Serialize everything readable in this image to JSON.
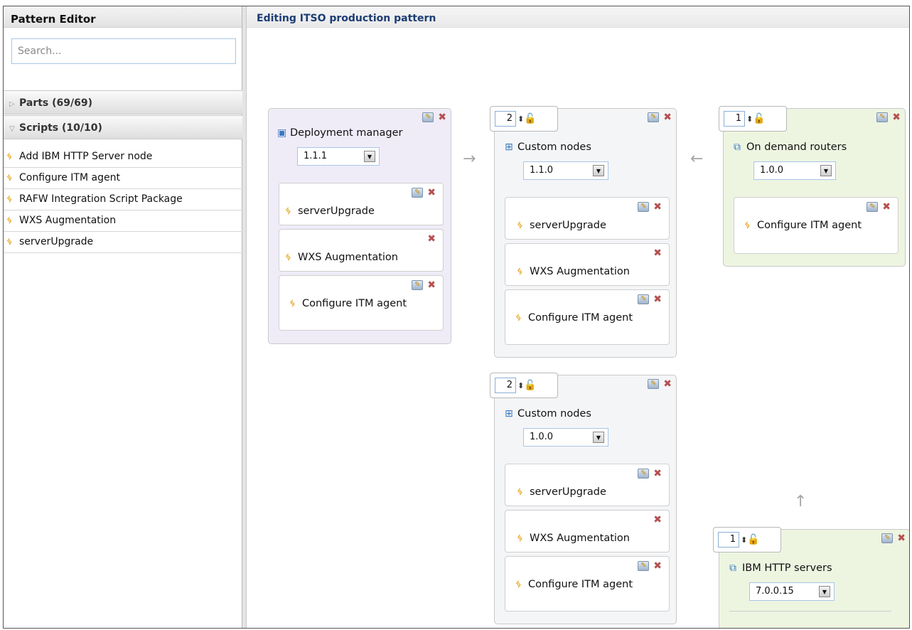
{
  "sidebar": {
    "title": "Pattern Editor",
    "search_placeholder": "Search...",
    "parts_header": "Parts (69/69)",
    "scripts_header": "Scripts (10/10)",
    "scripts": [
      "Add IBM HTTP Server node",
      "Configure ITM agent",
      "RAFW Integration Script Package",
      "WXS Augmentation",
      "serverUpgrade"
    ]
  },
  "main": {
    "title": "Editing ITSO production pattern",
    "parts": {
      "deployment_manager": {
        "title": "Deployment manager",
        "version": "1.1.1",
        "scripts": [
          "serverUpgrade",
          "WXS Augmentation",
          "Configure ITM agent"
        ]
      },
      "custom_nodes_1": {
        "count": "2",
        "title": "Custom nodes",
        "version": "1.1.0",
        "scripts": [
          "serverUpgrade",
          "WXS Augmentation",
          "Configure ITM agent"
        ]
      },
      "on_demand_routers": {
        "count": "1",
        "title": "On demand routers",
        "version": "1.0.0",
        "scripts": [
          "Configure ITM agent"
        ]
      },
      "custom_nodes_2": {
        "count": "2",
        "title": "Custom nodes",
        "version": "1.0.0",
        "scripts": [
          "serverUpgrade",
          "WXS Augmentation",
          "Configure ITM agent"
        ]
      },
      "ibm_http_servers": {
        "count": "1",
        "title": "IBM HTTP servers",
        "version": "7.0.0.15"
      }
    }
  }
}
